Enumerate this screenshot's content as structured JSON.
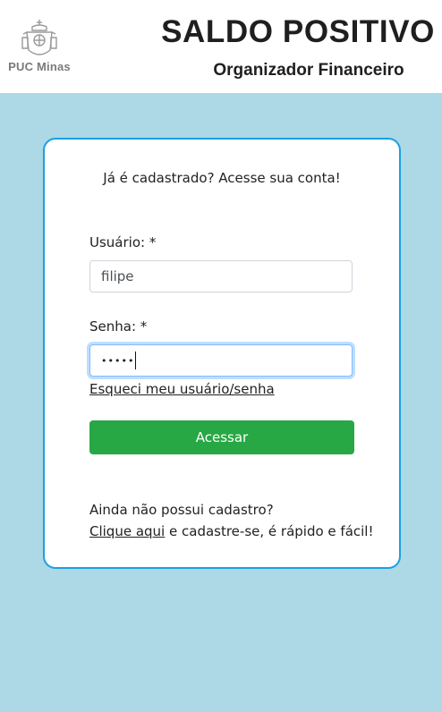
{
  "header": {
    "logo_text": "PUC Minas",
    "title": "SALDO POSITIVO",
    "subtitle": "Organizador Financeiro"
  },
  "login": {
    "intro": "Já é cadastrado? Acesse sua conta!",
    "username_label": "Usuário: *",
    "username_value": "filipe",
    "password_label": "Senha: *",
    "password_value": "•••••",
    "forgot_link": "Esqueci meu usuário/senha",
    "submit_label": "Acessar",
    "signup_prompt": "Ainda não possui cadastro?",
    "signup_link": "Clique aqui",
    "signup_rest": " e cadastre-se, é rápido e fácil!"
  },
  "colors": {
    "background": "#add8e6",
    "card_border": "#19a0e6",
    "button": "#28a745"
  },
  "icons": {
    "logo": "puc-minas-crest-icon"
  }
}
